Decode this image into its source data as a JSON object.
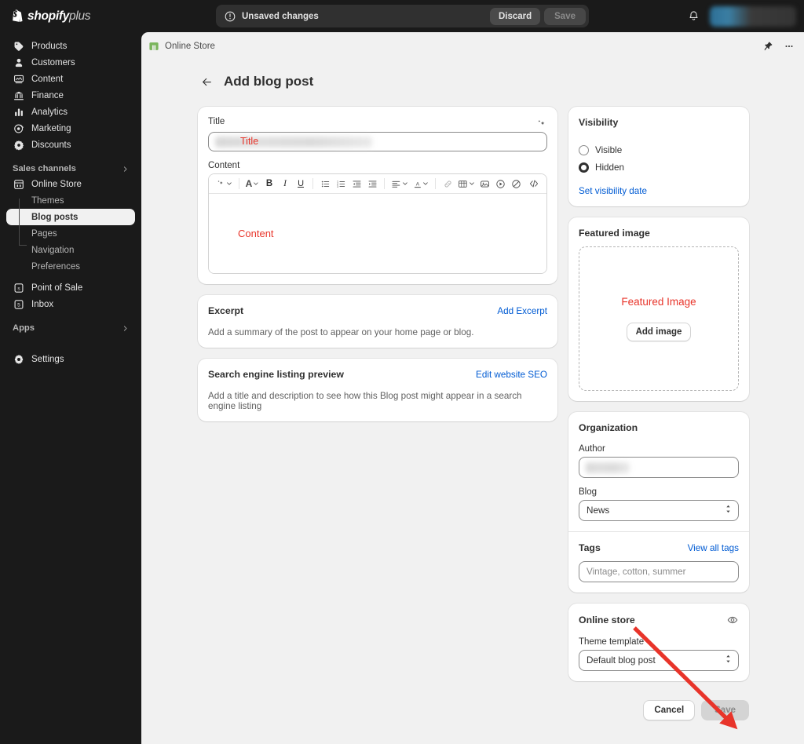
{
  "topbar": {
    "brand_name": "shopify",
    "brand_suffix": "plus",
    "brand_icon": "shopify-bag-icon",
    "savebar": {
      "icon": "alert-circle-icon",
      "message": "Unsaved changes",
      "discard_label": "Discard",
      "save_label": "Save"
    },
    "notifications_icon": "bell-icon",
    "account_avatar": "user-avatar"
  },
  "sidebar": {
    "items": [
      {
        "label": "Products",
        "icon": "tag-icon",
        "active": false
      },
      {
        "label": "Customers",
        "icon": "person-icon",
        "active": false
      },
      {
        "label": "Content",
        "icon": "content-icon",
        "active": false
      },
      {
        "label": "Finance",
        "icon": "bank-icon",
        "active": false
      },
      {
        "label": "Analytics",
        "icon": "bar-chart-icon",
        "active": false
      },
      {
        "label": "Marketing",
        "icon": "megaphone-icon",
        "active": false
      },
      {
        "label": "Discounts",
        "icon": "discount-icon",
        "active": false
      }
    ],
    "sales_channels": {
      "label": "Sales channels",
      "chevron_icon": "chevron-right-icon",
      "online_store": {
        "label": "Online Store",
        "icon": "storefront-icon",
        "children": [
          {
            "label": "Themes",
            "active": false
          },
          {
            "label": "Blog posts",
            "active": true
          },
          {
            "label": "Pages",
            "active": false
          },
          {
            "label": "Navigation",
            "active": false
          },
          {
            "label": "Preferences",
            "active": false
          }
        ]
      },
      "extra_channels": [
        {
          "label": "Point of Sale",
          "icon": "point-of-sale-icon"
        },
        {
          "label": "Inbox",
          "icon": "inbox-icon"
        }
      ]
    },
    "apps": {
      "label": "Apps",
      "chevron_icon": "chevron-right-icon"
    },
    "settings": {
      "label": "Settings",
      "icon": "gear-icon"
    }
  },
  "breadcrumb": {
    "store_name": "Online Store",
    "store_icon": "online-store-favicon",
    "pin_icon": "pin-icon",
    "more_icon": "ellipsis-icon"
  },
  "page": {
    "back_icon": "arrow-left-icon",
    "title": "Add blog post"
  },
  "title_card": {
    "label": "Title",
    "placeholder": "",
    "value": "",
    "magic_icon": "magic-sparkle-icon",
    "annotation": "Title"
  },
  "content_card": {
    "label": "Content",
    "annotation": "Content",
    "toolbar": [
      {
        "name": "magic-sparkle-icon",
        "glyph": "✧",
        "caret": true
      },
      {
        "name": "separator"
      },
      {
        "name": "text-style-icon",
        "glyph": "A",
        "caret": true
      },
      {
        "name": "bold-icon",
        "glyph": "B"
      },
      {
        "name": "italic-icon",
        "glyph": "I"
      },
      {
        "name": "underline-icon",
        "glyph": "U"
      },
      {
        "name": "separator"
      },
      {
        "name": "bulleted-list-icon"
      },
      {
        "name": "numbered-list-icon"
      },
      {
        "name": "outdent-icon"
      },
      {
        "name": "indent-icon"
      },
      {
        "name": "separator"
      },
      {
        "name": "align-icon",
        "caret": true
      },
      {
        "name": "text-color-icon",
        "glyph": "A",
        "caret": true
      },
      {
        "name": "separator"
      },
      {
        "name": "link-icon"
      },
      {
        "name": "table-icon",
        "caret": true
      },
      {
        "name": "insert-image-icon"
      },
      {
        "name": "insert-video-icon"
      },
      {
        "name": "clear-formatting-icon"
      },
      {
        "name": "code-view-icon",
        "glyph": "</>"
      }
    ]
  },
  "excerpt_card": {
    "title": "Excerpt",
    "action_label": "Add Excerpt",
    "description": "Add a summary of the post to appear on your home page or blog."
  },
  "seo_card": {
    "title": "Search engine listing preview",
    "action_label": "Edit website SEO",
    "description": "Add a title and description to see how this Blog post might appear in a search engine listing"
  },
  "visibility_card": {
    "title": "Visibility",
    "options": [
      {
        "label": "Visible",
        "selected": false
      },
      {
        "label": "Hidden",
        "selected": true
      }
    ],
    "link_label": "Set visibility date"
  },
  "featured_image_card": {
    "title": "Featured image",
    "annotation": "Featured Image",
    "button_label": "Add image"
  },
  "organization_card": {
    "title": "Organization",
    "author": {
      "label": "Author",
      "value": "",
      "placeholder": ""
    },
    "blog": {
      "label": "Blog",
      "value": "News",
      "caret_icon": "select-caret-icon"
    },
    "tags": {
      "label": "Tags",
      "action_label": "View all tags",
      "placeholder": "Vintage, cotton, summer",
      "value": ""
    }
  },
  "online_store_card": {
    "title": "Online store",
    "eye_icon": "eye-icon",
    "theme_template": {
      "label": "Theme template",
      "value": "Default blog post",
      "caret_icon": "select-caret-icon"
    }
  },
  "footer": {
    "cancel_label": "Cancel",
    "save_label": "Save"
  },
  "annotation": {
    "arrow_color": "#e8342a",
    "target": "save-button",
    "red_color": "#e8342a"
  }
}
